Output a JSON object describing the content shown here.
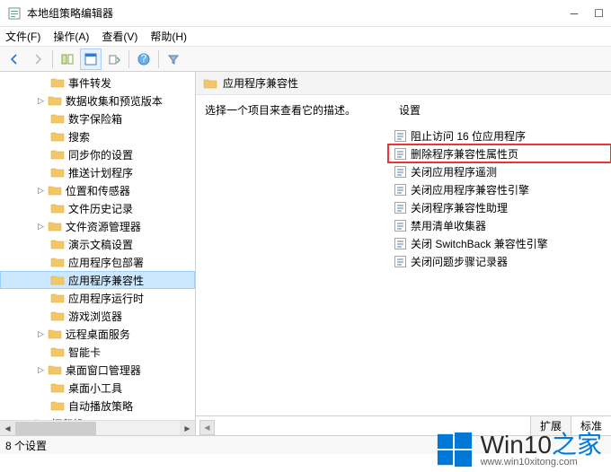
{
  "window": {
    "title": "本地组策略编辑器"
  },
  "menus": {
    "file": "文件(F)",
    "action": "操作(A)",
    "view": "查看(V)",
    "help": "帮助(H)"
  },
  "tree": {
    "items": [
      {
        "label": "事件转发",
        "hasChildren": false
      },
      {
        "label": "数据收集和预览版本",
        "hasChildren": true
      },
      {
        "label": "数字保险箱",
        "hasChildren": false
      },
      {
        "label": "搜索",
        "hasChildren": false
      },
      {
        "label": "同步你的设置",
        "hasChildren": false
      },
      {
        "label": "推送计划程序",
        "hasChildren": false
      },
      {
        "label": "位置和传感器",
        "hasChildren": true
      },
      {
        "label": "文件历史记录",
        "hasChildren": false
      },
      {
        "label": "文件资源管理器",
        "hasChildren": true
      },
      {
        "label": "演示文稿设置",
        "hasChildren": false
      },
      {
        "label": "应用程序包部署",
        "hasChildren": false
      },
      {
        "label": "应用程序兼容性",
        "hasChildren": false,
        "selected": true
      },
      {
        "label": "应用程序运行时",
        "hasChildren": false
      },
      {
        "label": "游戏浏览器",
        "hasChildren": false
      },
      {
        "label": "远程桌面服务",
        "hasChildren": true
      },
      {
        "label": "智能卡",
        "hasChildren": false
      },
      {
        "label": "桌面窗口管理器",
        "hasChildren": true
      },
      {
        "label": "桌面小工具",
        "hasChildren": false
      },
      {
        "label": "自动播放策略",
        "hasChildren": false
      }
    ],
    "printer": "打印机"
  },
  "right": {
    "path_title": "应用程序兼容性",
    "description": "选择一个项目来查看它的描述。",
    "settings_header": "设置",
    "settings": [
      "阻止访问 16 位应用程序",
      "删除程序兼容性属性页",
      "关闭应用程序遥测",
      "关闭应用程序兼容性引擎",
      "关闭程序兼容性助理",
      "禁用清单收集器",
      "关闭 SwitchBack 兼容性引擎",
      "关闭问题步骤记录器"
    ],
    "highlight_index": 1
  },
  "tabs": {
    "extended": "扩展",
    "standard": "标准"
  },
  "status": {
    "text": "8 个设置"
  },
  "watermark": {
    "brand_a": "Win10",
    "brand_b": "之家",
    "domain": "www.win10xitong.com"
  }
}
